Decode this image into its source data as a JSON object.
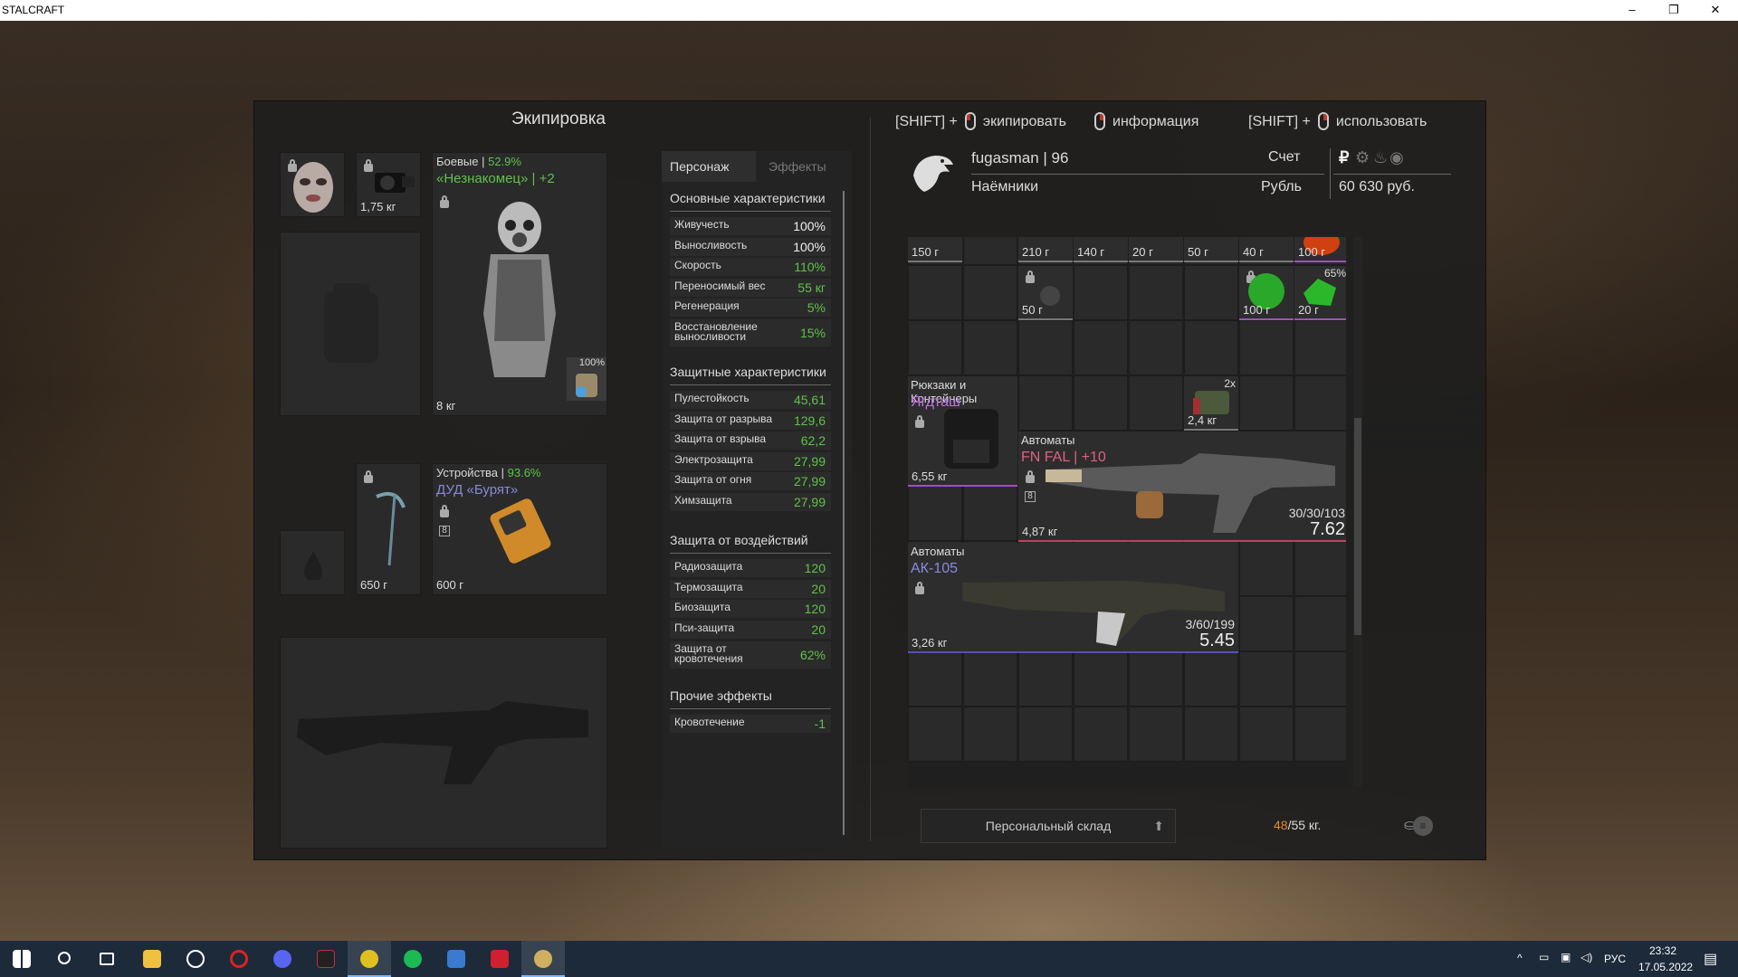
{
  "window": {
    "title": "STALCRAFT",
    "controls": [
      "–",
      "❐",
      "✕"
    ]
  },
  "panel": {
    "title": "Экипировка",
    "hints": [
      {
        "prefix": "[SHIFT] +",
        "mouse": "left",
        "label": "экипировать"
      },
      {
        "prefix": "",
        "mouse": "right",
        "label": "информация"
      },
      {
        "prefix": "[SHIFT] +",
        "mouse": "right",
        "label": "использовать"
      }
    ]
  },
  "equipment": {
    "mask_slot": {
      "weight": ""
    },
    "device_slot": {
      "weight": "1,75 кг"
    },
    "armor": {
      "category": "Боевые",
      "category_pct": "52.9%",
      "name": "«Незнакомец»",
      "upgrade": "+2",
      "weight": "8 кг",
      "container_pct": "100%"
    },
    "tool_slot": {
      "weight": "650 г"
    },
    "detector": {
      "category": "Устройства",
      "category_pct": "93.6%",
      "name": "ДУД «Бурят»",
      "weight": "600 г"
    }
  },
  "stats": {
    "tabs": [
      "Персонаж",
      "Эффекты"
    ],
    "main_title": "Основные характеристики",
    "main": [
      {
        "label": "Живучесть",
        "value": "100%",
        "color": "white"
      },
      {
        "label": "Выносливость",
        "value": "100%",
        "color": "white"
      },
      {
        "label": "Скорость",
        "value": "110%",
        "color": "green"
      },
      {
        "label": "Переносимый вес",
        "value": "55 кг",
        "color": "green"
      },
      {
        "label": "Регенерация",
        "value": "5%",
        "color": "green"
      },
      {
        "label": "Восстановление выносливости",
        "value": "15%",
        "color": "green"
      }
    ],
    "protect_title": "Защитные характеристики",
    "protect": [
      {
        "label": "Пулестойкость",
        "value": "45,61"
      },
      {
        "label": "Защита от разрыва",
        "value": "129,6"
      },
      {
        "label": "Защита от взрыва",
        "value": "62,2"
      },
      {
        "label": "Электрозащита",
        "value": "27,99"
      },
      {
        "label": "Защита от огня",
        "value": "27,99"
      },
      {
        "label": "Химзащита",
        "value": "27,99"
      }
    ],
    "resist_title": "Защита от воздействий",
    "resist": [
      {
        "label": "Радиозащита",
        "value": "120"
      },
      {
        "label": "Термозащита",
        "value": "20"
      },
      {
        "label": "Биозащита",
        "value": "120"
      },
      {
        "label": "Пси-защита",
        "value": "20"
      },
      {
        "label": "Защита от кровотечения",
        "value": "62%"
      }
    ],
    "other_title": "Прочие эффекты",
    "other": [
      {
        "label": "Кровотечение",
        "value": "-1"
      }
    ]
  },
  "profile": {
    "username": "fugasman",
    "level": "96",
    "faction": "Наёмники",
    "account_label": "Счет",
    "currency_label": "Рубль",
    "money": "60 630 руб.",
    "currency_icons": [
      "ruble-icon",
      "gear-icon",
      "flame-icon",
      "coin-icon"
    ]
  },
  "inventory": {
    "top_row_weights": [
      "150 г",
      "",
      "210 г",
      "140 г",
      "20 г",
      "50 г",
      "40 г",
      "100 г"
    ],
    "row2": [
      {
        "col": 2,
        "weight": "50 г",
        "locked": true
      },
      {
        "col": 6,
        "weight": "100 г",
        "locked": true
      },
      {
        "col": 7,
        "weight": "20 г",
        "pct": "65%"
      }
    ],
    "backpack": {
      "category": "Рюкзаки и Контейнеры",
      "name": "Ягдташ",
      "weight": "6,55 кг"
    },
    "small_item": {
      "weight": "2,4 кг",
      "count": "2x"
    },
    "fnfal": {
      "category": "Автоматы",
      "name": "FN FAL",
      "upgrade": "+10",
      "weight": "4,87 кг",
      "ammo": "30/30/103",
      "caliber": "7.62"
    },
    "ak105": {
      "category": "Автоматы",
      "name": "АК-105",
      "weight": "3,26 кг",
      "ammo": "3/60/199",
      "caliber": "5.45"
    }
  },
  "footer": {
    "storage_label": "Персональный склад",
    "weight_current": "48",
    "weight_max": "/55 кг."
  },
  "taskbar": {
    "apps": [
      "windows-start-icon",
      "search-icon",
      "task-view-icon",
      "file-explorer-icon",
      "steam-icon",
      "opera-icon",
      "discord-icon",
      "app-x-icon",
      "app-yellow-icon",
      "spotify-icon",
      "app-blue-icon",
      "app-red-icon",
      "stalcraft-icon"
    ],
    "tray_lang": "РУС",
    "time": "23:32",
    "date": "17.05.2022"
  }
}
